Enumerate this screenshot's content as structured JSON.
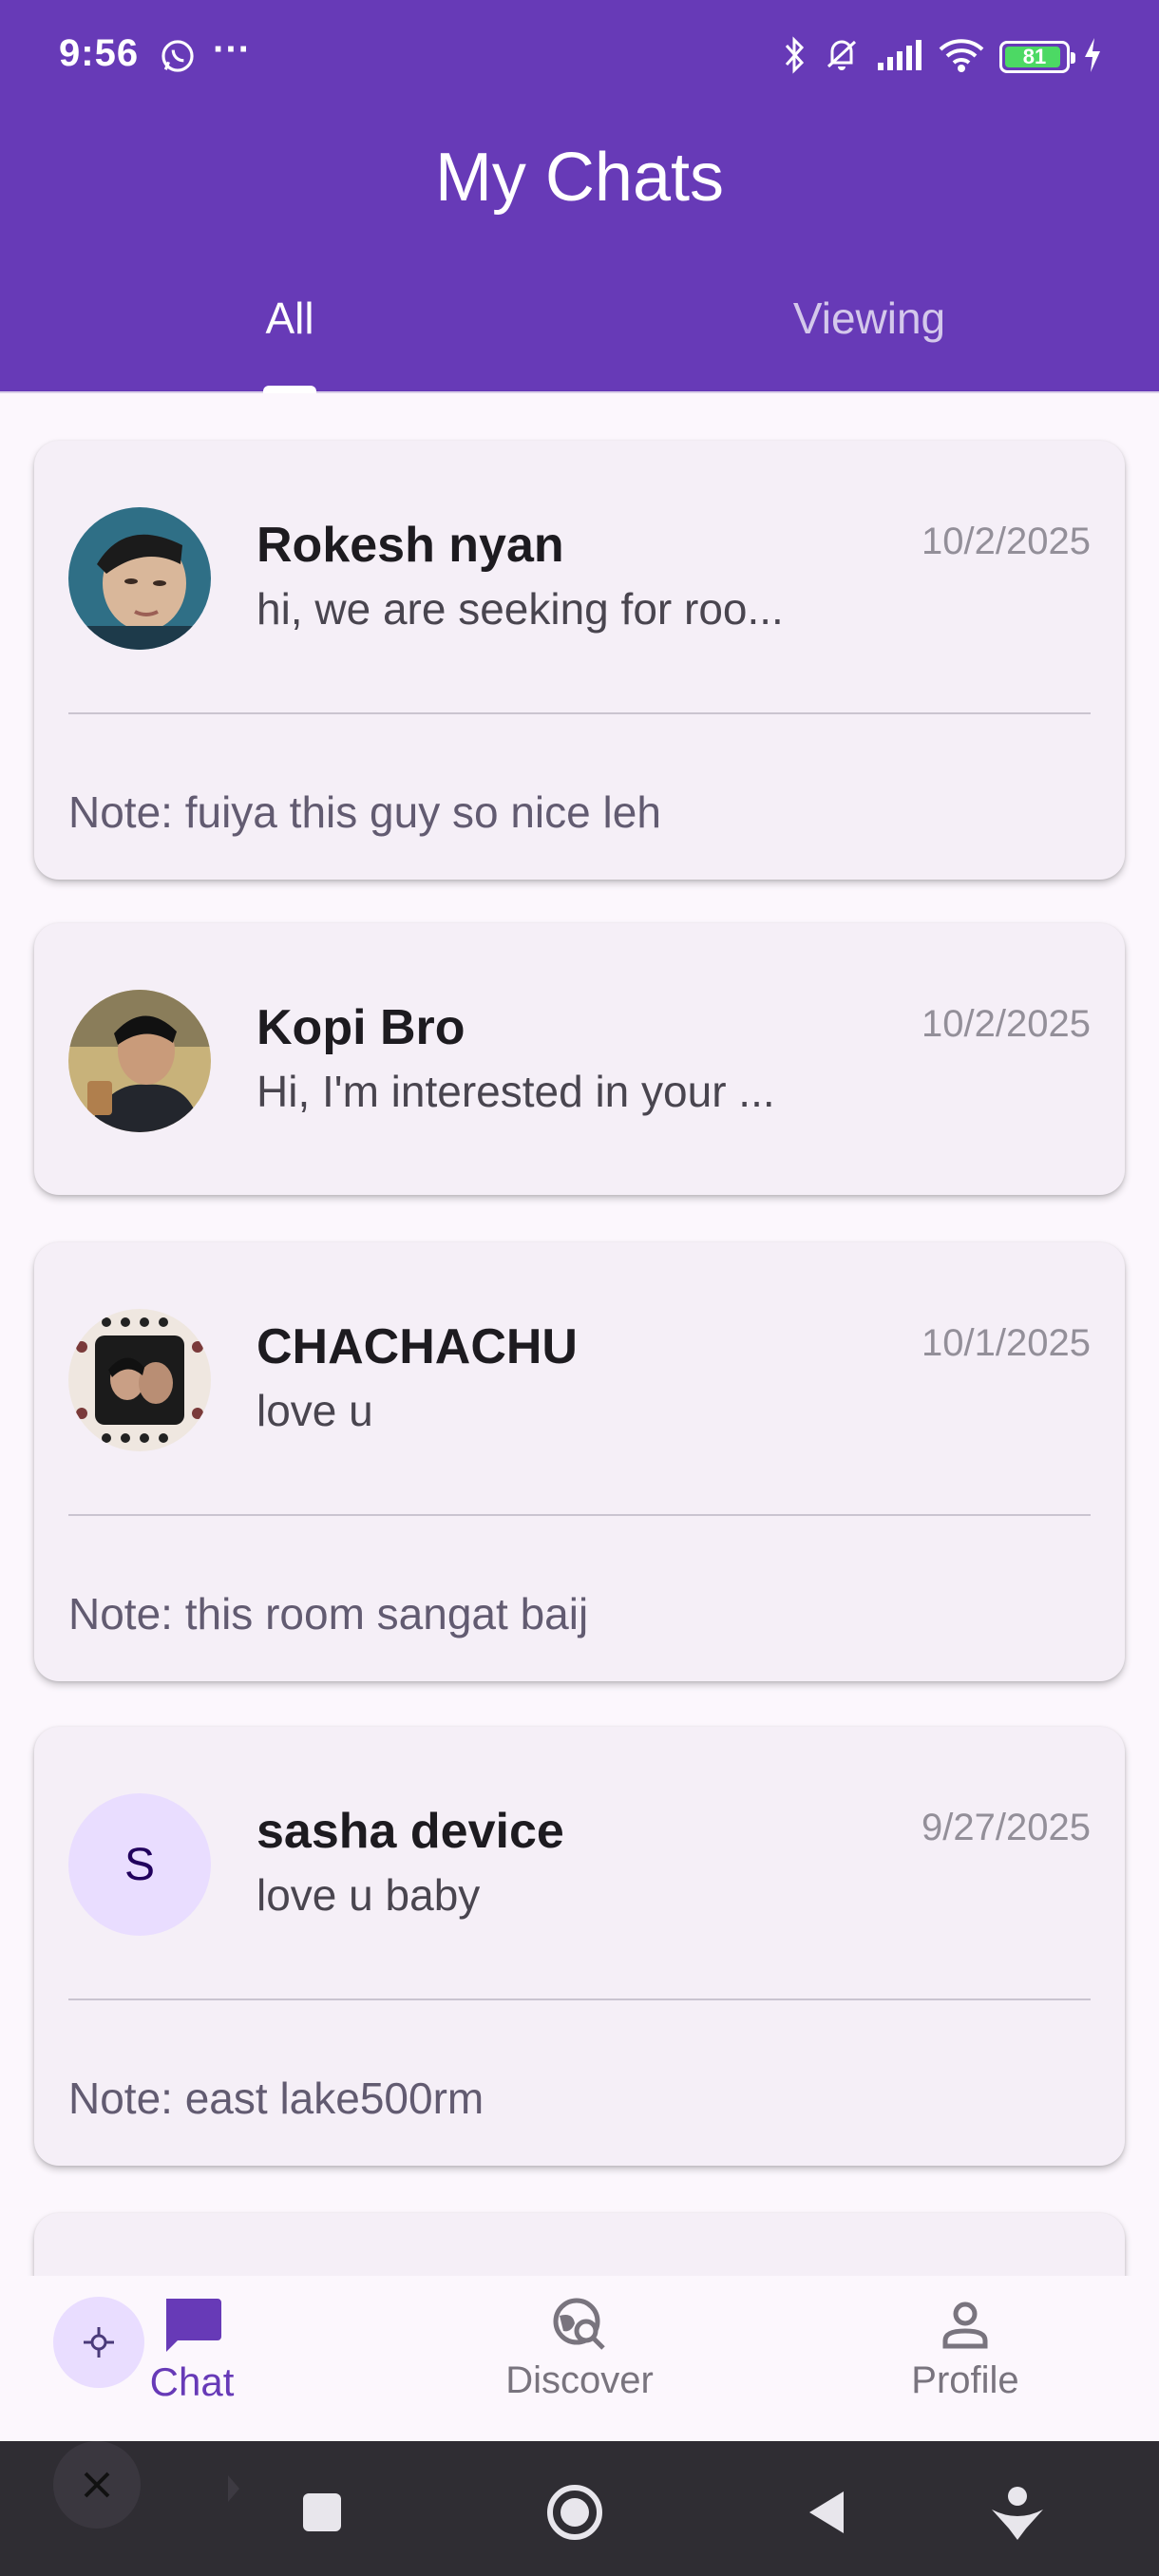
{
  "status_bar": {
    "time": "9:56",
    "dots": "···",
    "battery": "81"
  },
  "app_bar": {
    "title": "My Chats"
  },
  "tabs": [
    {
      "label": "All",
      "active": true
    },
    {
      "label": "Viewing",
      "active": false
    }
  ],
  "chats": [
    {
      "name": "Rokesh nyan",
      "preview": "hi, we are seeking for roo...",
      "date": "10/2/2025",
      "note": "Note: fuiya this guy so nice leh",
      "avatar": "photo"
    },
    {
      "name": "Kopi Bro",
      "preview": "Hi, I'm interested in your ...",
      "date": "10/2/2025",
      "note": "",
      "avatar": "photo"
    },
    {
      "name": "CHACHACHU",
      "preview": "love u",
      "date": "10/1/2025",
      "note": "Note: this room sangat baij",
      "avatar": "photo"
    },
    {
      "name": "sasha device",
      "preview": "love u baby",
      "date": "9/27/2025",
      "note": "Note: east lake500rm",
      "avatar_letter": "S"
    }
  ],
  "bottom_nav": {
    "items": [
      {
        "label": "Chat",
        "icon": "chat-bubble-icon",
        "active": true
      },
      {
        "label": "Discover",
        "icon": "discover-globe-search-icon",
        "active": false
      },
      {
        "label": "Profile",
        "icon": "person-icon",
        "active": false
      }
    ]
  },
  "colors": {
    "primary": "#673ab7",
    "card": "#f5eff7",
    "background": "#fcf7fd",
    "avatar_letter_bg": "#e9ddff"
  }
}
